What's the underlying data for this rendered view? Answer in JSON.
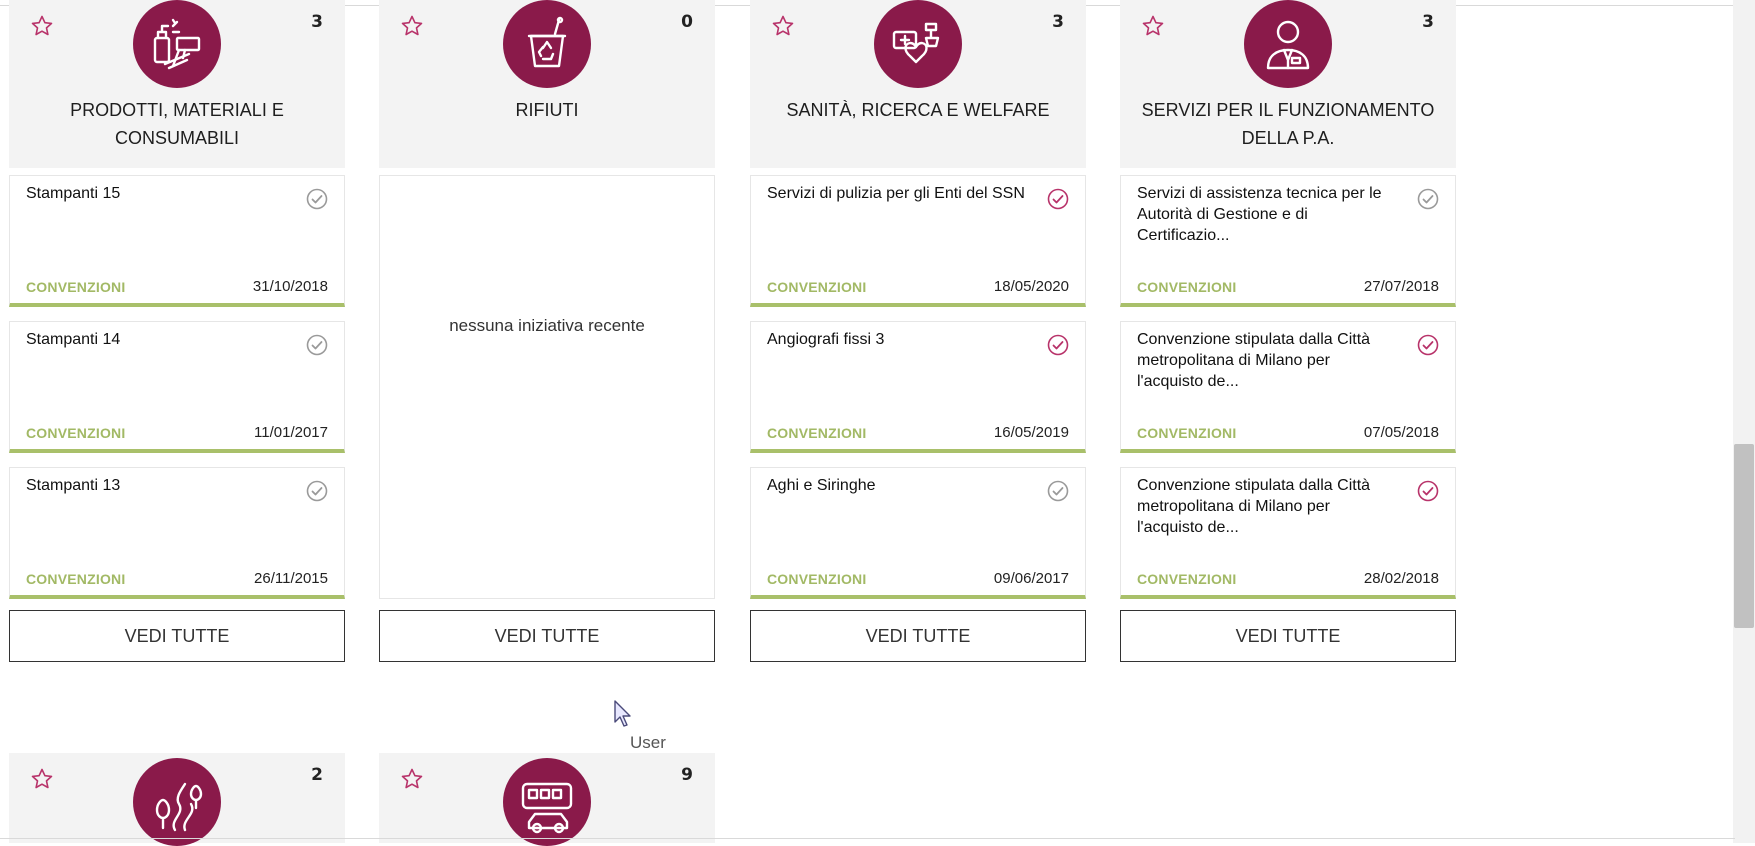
{
  "colors": {
    "brand": "#8a1a4a",
    "accent_green": "#a9c06a",
    "check_active": "#b8336a",
    "check_inactive": "#9a9a9a"
  },
  "categories": [
    {
      "title": "PRODOTTI, MATERIALI E CONSUMABILI",
      "count": "3",
      "icon": "office-supplies-icon",
      "cards": [
        {
          "title": "Stampanti 15",
          "type": "CONVENZIONI",
          "date": "31/10/2018",
          "status": "inactive"
        },
        {
          "title": "Stampanti 14",
          "type": "CONVENZIONI",
          "date": "11/01/2017",
          "status": "inactive"
        },
        {
          "title": "Stampanti 13",
          "type": "CONVENZIONI",
          "date": "26/11/2015",
          "status": "inactive"
        }
      ],
      "button": "VEDI TUTTE"
    },
    {
      "title": "RIFIUTI",
      "count": "0",
      "icon": "recycle-bin-icon",
      "empty_text": "nessuna iniziativa recente",
      "button": "VEDI TUTTE"
    },
    {
      "title": "SANITÀ, RICERCA E WELFARE",
      "count": "3",
      "icon": "healthcare-icon",
      "cards": [
        {
          "title": "Servizi di pulizia per gli Enti del SSN",
          "type": "CONVENZIONI",
          "date": "18/05/2020",
          "status": "active"
        },
        {
          "title": "Angiografi fissi 3",
          "type": "CONVENZIONI",
          "date": "16/05/2019",
          "status": "active"
        },
        {
          "title": "Aghi e Siringhe",
          "type": "CONVENZIONI",
          "date": "09/06/2017",
          "status": "inactive"
        }
      ],
      "button": "VEDI TUTTE"
    },
    {
      "title": "SERVIZI PER IL FUNZIONAMENTO DELLA P.A.",
      "count": "3",
      "icon": "public-official-icon",
      "cards": [
        {
          "title": "Servizi di assistenza tecnica per le Autorità di Gestione e di Certificazio...",
          "type": "CONVENZIONI",
          "date": "27/07/2018",
          "status": "inactive"
        },
        {
          "title": "Convenzione stipulata dalla Città metropolitana di Milano per l'acquisto de...",
          "type": "CONVENZIONI",
          "date": "07/05/2018",
          "status": "active"
        },
        {
          "title": "Convenzione stipulata dalla Città metropolitana di Milano per l'acquisto de...",
          "type": "CONVENZIONI",
          "date": "28/02/2018",
          "status": "active"
        }
      ],
      "button": "VEDI TUTTE"
    }
  ],
  "row2": [
    {
      "count": "2",
      "icon": "landscape-road-icon"
    },
    {
      "count": "9",
      "icon": "vehicles-icon"
    }
  ],
  "tooltip": "User"
}
